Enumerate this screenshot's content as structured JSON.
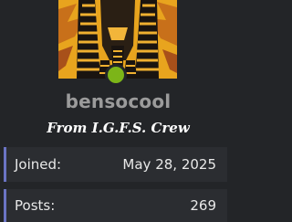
{
  "profile": {
    "username": "bensocool",
    "title": "From I.G.F.S. Crew",
    "status_color": "#7cb518"
  },
  "stats": {
    "joined_label": "Joined:",
    "joined_value": "May 28, 2025",
    "posts_label": "Posts:",
    "posts_value": "269"
  },
  "colors": {
    "background": "#232528",
    "row_background": "#2b2d31",
    "row_accent": "#6b74c4",
    "username": "#9b9b9b"
  }
}
